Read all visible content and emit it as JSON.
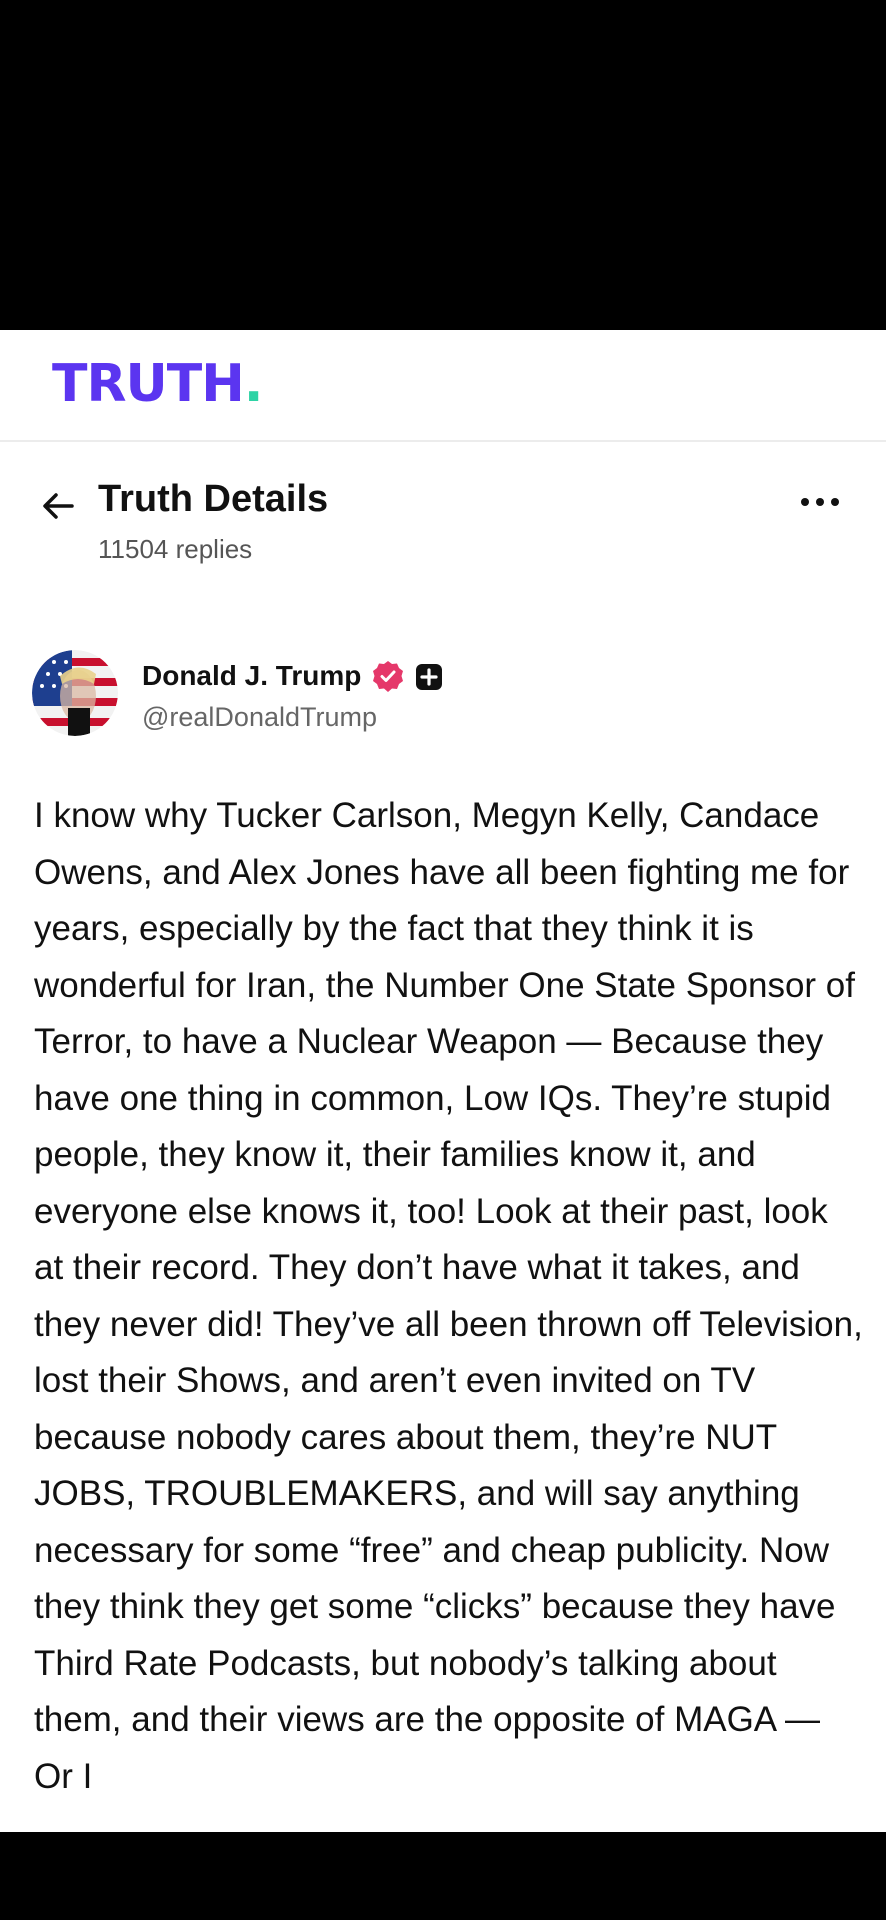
{
  "app": {
    "logo_text": "TRUTH",
    "logo_dot": ".",
    "brand_color": "#5b35f0",
    "accent_color": "#2ed3a5"
  },
  "header": {
    "title": "Truth Details",
    "replies": "11504 replies",
    "back_icon": "arrow-left-icon",
    "more_icon": "more-horizontal-icon"
  },
  "post": {
    "author_name": "Donald J. Trump",
    "handle": "@realDonaldTrump",
    "verified_icon": "verified-badge-icon",
    "plus_icon": "plus-badge-icon",
    "body": "I know why Tucker Carlson, Megyn Kelly, Candace Owens, and Alex Jones have all been fighting me for years, especially by the fact that they think it is wonderful for Iran, the Number One State Sponsor of Terror, to have a Nuclear Weapon — Because they have one thing in common, Low IQs. They’re stupid people, they know it, their families know it, and everyone else knows it, too! Look at their past, look at their record. They don’t have what it takes, and they never did! They’ve all been thrown off Television, lost their Shows, and aren’t even invited on TV because nobody cares about them, they’re NUT JOBS, TROUBLEMAKERS, and will say anything necessary for some “free” and cheap publicity. Now they think they get some “clicks” because they have Third Rate Podcasts, but nobody’s talking about them, and their views are the opposite of MAGA — Or I"
  }
}
